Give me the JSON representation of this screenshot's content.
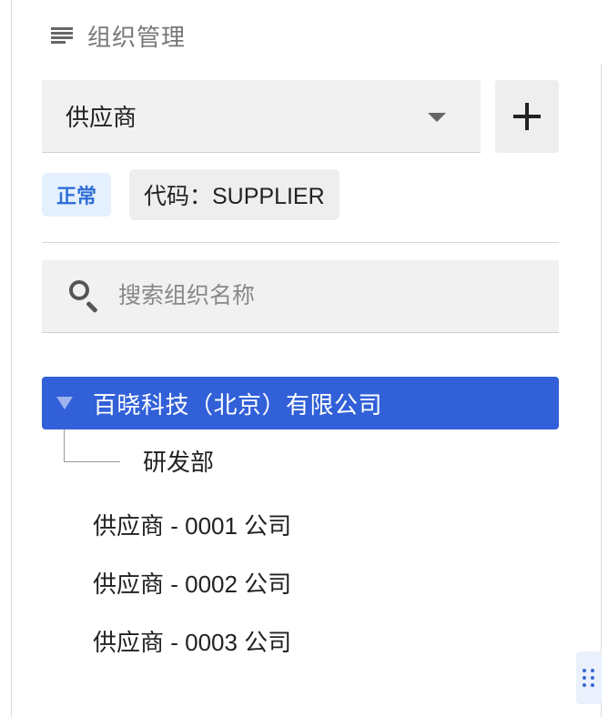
{
  "header": {
    "title": "组织管理",
    "icon": "menu-icon"
  },
  "type_select": {
    "value": "供应商",
    "icon": "chevron-down-icon"
  },
  "add_button": {
    "icon": "plus-icon"
  },
  "status_chip": {
    "label": "正常",
    "color": "#2f6fd6"
  },
  "code_chip": {
    "label": "代码：SUPPLIER"
  },
  "search": {
    "placeholder": "搜索组织名称",
    "icon": "search-icon"
  },
  "tree": {
    "root": {
      "label": "百晓科技（北京）有限公司",
      "selected": true,
      "expanded": true,
      "highlight_color": "#3160d8"
    },
    "children": [
      {
        "label": "研发部"
      }
    ]
  },
  "list": {
    "items": [
      {
        "label": "供应商 - 0001 公司"
      },
      {
        "label": "供应商 - 0002 公司"
      },
      {
        "label": "供应商 - 0003 公司"
      }
    ]
  },
  "drag_handle": {
    "icon": "drag-handle-icon"
  }
}
